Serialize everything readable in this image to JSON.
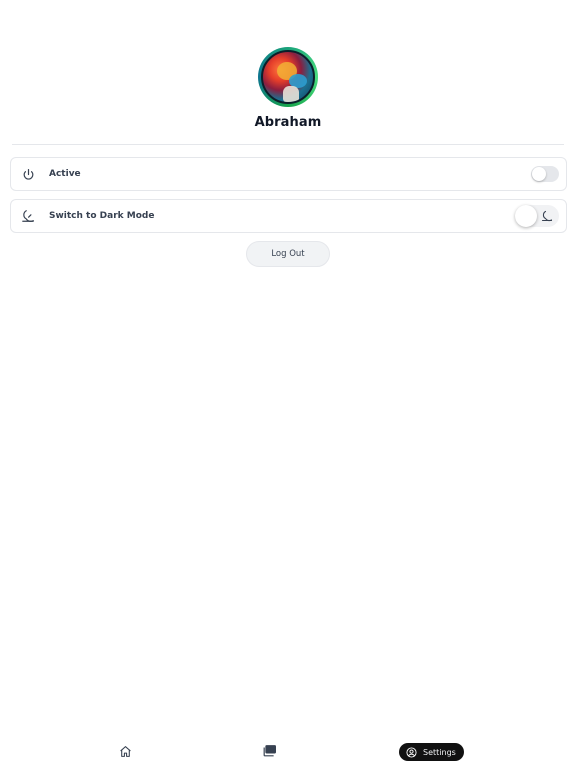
{
  "profile": {
    "name": "Abraham"
  },
  "settings": {
    "active_label": "Active",
    "active_on": false,
    "dark_mode_label": "Switch to Dark Mode",
    "dark_mode_on": false
  },
  "actions": {
    "logout_label": "Log Out"
  },
  "bottom_nav": {
    "items": [
      {
        "icon": "home-icon",
        "label": ""
      },
      {
        "icon": "library-icon",
        "label": ""
      },
      {
        "icon": "user-circle-icon",
        "label": "Settings",
        "active": true
      }
    ]
  },
  "colors": {
    "active_nav_bg": "#111111",
    "toggle_off": "#e5e7eb",
    "border": "#e5e7eb"
  }
}
